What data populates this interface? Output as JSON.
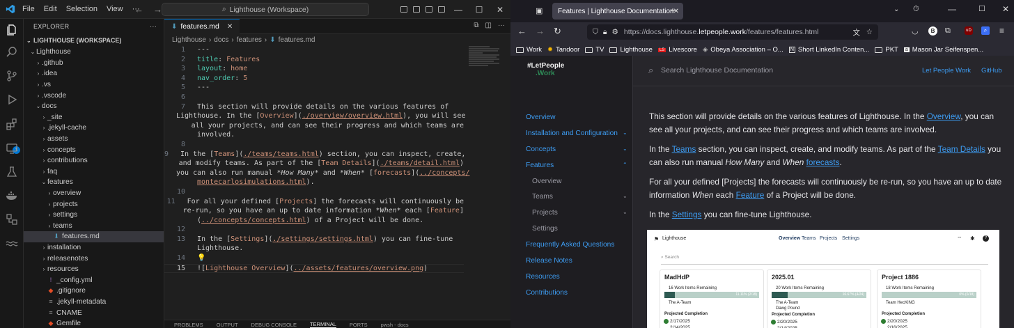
{
  "vscode": {
    "menu": [
      "File",
      "Edit",
      "Selection",
      "View"
    ],
    "search": "Lighthouse (Workspace)",
    "explorer": {
      "title": "EXPLORER",
      "workspace": "LIGHTHOUSE (WORKSPACE)",
      "tree": [
        {
          "label": "Lighthouse",
          "depth": 0,
          "kind": "folder-open"
        },
        {
          "label": ".github",
          "depth": 1,
          "kind": "folder"
        },
        {
          "label": ".idea",
          "depth": 1,
          "kind": "folder"
        },
        {
          "label": ".vs",
          "depth": 1,
          "kind": "folder"
        },
        {
          "label": ".vscode",
          "depth": 1,
          "kind": "folder"
        },
        {
          "label": "docs",
          "depth": 1,
          "kind": "folder-open"
        },
        {
          "label": "_site",
          "depth": 2,
          "kind": "folder"
        },
        {
          "label": ".jekyll-cache",
          "depth": 2,
          "kind": "folder"
        },
        {
          "label": "assets",
          "depth": 2,
          "kind": "folder"
        },
        {
          "label": "concepts",
          "depth": 2,
          "kind": "folder"
        },
        {
          "label": "contributions",
          "depth": 2,
          "kind": "folder"
        },
        {
          "label": "faq",
          "depth": 2,
          "kind": "folder"
        },
        {
          "label": "features",
          "depth": 2,
          "kind": "folder-open"
        },
        {
          "label": "overview",
          "depth": 3,
          "kind": "folder"
        },
        {
          "label": "projects",
          "depth": 3,
          "kind": "folder"
        },
        {
          "label": "settings",
          "depth": 3,
          "kind": "folder"
        },
        {
          "label": "teams",
          "depth": 3,
          "kind": "folder"
        },
        {
          "label": "features.md",
          "depth": 3,
          "kind": "md",
          "selected": true
        },
        {
          "label": "installation",
          "depth": 2,
          "kind": "folder"
        },
        {
          "label": "releasenotes",
          "depth": 2,
          "kind": "folder"
        },
        {
          "label": "resources",
          "depth": 2,
          "kind": "folder"
        },
        {
          "label": "_config.yml",
          "depth": 2,
          "kind": "yml"
        },
        {
          "label": ".gitignore",
          "depth": 2,
          "kind": "git"
        },
        {
          "label": ".jekyll-metadata",
          "depth": 2,
          "kind": "file"
        },
        {
          "label": "CNAME",
          "depth": 2,
          "kind": "file"
        },
        {
          "label": "Gemfile",
          "depth": 2,
          "kind": "gem"
        }
      ]
    },
    "tab": "features.md",
    "breadcrumb": [
      "Lighthouse",
      "docs",
      "features",
      "features.md"
    ],
    "panel": [
      "PROBLEMS",
      "OUTPUT",
      "DEBUG CONSOLE",
      "TERMINAL",
      "PORTS",
      "pwsh - docs"
    ]
  },
  "firefox": {
    "tab_title": "Features | Lighthouse Documentation",
    "url_pre": "https://docs.lighthouse.",
    "url_host": "letpeople.work",
    "url_post": "/features/features.html",
    "bookmarks": [
      "Work",
      "Tandoor",
      "TV",
      "Lighthouse",
      "Livescore",
      "Obeya Association – O...",
      "Short LinkedIn Conten...",
      "PKT",
      "Mason Jar Seifenspen..."
    ],
    "site": {
      "logo_line1": "#LetPeople",
      "logo_line2": ".Work",
      "search_placeholder": "Search Lighthouse Documentation",
      "top_links": [
        "Let People Work",
        "GitHub"
      ],
      "nav": [
        "Overview",
        "Installation and Configuration",
        "Concepts",
        "Features",
        "Frequently Asked Questions",
        "Release Notes",
        "Resources",
        "Contributions"
      ],
      "nav_sub": [
        "Overview",
        "Teams",
        "Projects",
        "Settings"
      ],
      "p1a": "This section will provide details on the various features of Lighthouse. In the ",
      "p1link": "Overview",
      "p1b": ", you can see all your projects, and can see their progress and which teams are involved.",
      "p2a": "In the ",
      "p2link1": "Teams",
      "p2b": " section, you can inspect, create, and modify teams. As part of the ",
      "p2link2": "Team Details",
      "p2c": " you can also run manual ",
      "p2em1": "How Many",
      "p2d": " and ",
      "p2em2": "When",
      "p2e": " ",
      "p2link3": "forecasts",
      "p2f": ".",
      "p3a": "For all your defined [Projects] the forecasts will continuously be re-run, so you have an up to date information ",
      "p3em": "When",
      "p3b": " each ",
      "p3link": "Feature",
      "p3c": " of a Project will be done.",
      "p4a": "In the ",
      "p4link": "Settings",
      "p4b": " you can fine-tune Lighthouse."
    },
    "screenshot": {
      "brand": "Lighthouse",
      "menu": [
        "Overview",
        "Teams",
        "Projects",
        "Settings"
      ],
      "search": "Search",
      "cards": [
        {
          "name": "MadHdP",
          "remaining": "16 Work Items Remaining",
          "pct_label": "11.11% (2/18)",
          "progress": 0.1111,
          "team": "The A-Team",
          "completion": "Projected Completion",
          "dates": [
            "2/17/2025",
            "2/14/2025"
          ]
        },
        {
          "name": "2025.01",
          "remaining": "20 Work Items Remaining",
          "pct_label": "16.67% (4/24)",
          "progress": 0.1667,
          "team": "The A-Team",
          "team2": "Dawg Pound",
          "completion": "Projected Completion",
          "dates": [
            "2/20/2025",
            "2/14/2025"
          ]
        },
        {
          "name": "Project 1886",
          "remaining": "18 Work Items Remaining",
          "pct_label": "0% (0/18)",
          "progress": 0.0,
          "team": "Team HecKING",
          "completion": "Projected Completion",
          "dates": [
            "2/20/2025",
            "2/16/2025"
          ]
        }
      ]
    }
  },
  "colors": {
    "vscode_accent": "#0078d4",
    "link": "#3d9cf2",
    "progress_dark": "#2e5a52",
    "progress_light": "#b9d0c8"
  }
}
